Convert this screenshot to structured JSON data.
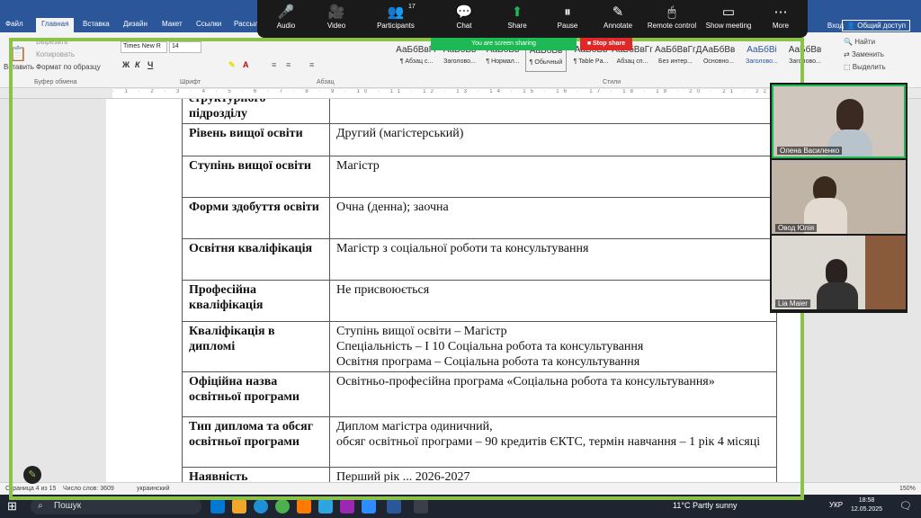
{
  "word": {
    "tabs": [
      "Файл",
      "Главная",
      "Вставка",
      "Дизайн",
      "Макет",
      "Ссылки",
      "Рассыл"
    ],
    "login": "Вход",
    "share": "Общий доступ",
    "clipboard": {
      "paste": "Вставить",
      "cut": "Вырезать",
      "copy": "Копировать",
      "format": "Формат по образцу",
      "group": "Буфер обмена"
    },
    "font": {
      "name": "Times New R",
      "size": "14",
      "group": "Шрифт"
    },
    "paragraph_group": "Абзац",
    "styles_group": "Стили",
    "styles": [
      {
        "preview": "АаБбВвГг",
        "label": "¶ Абзац с..."
      },
      {
        "preview": "АаБбВв",
        "label": "Заголово..."
      },
      {
        "preview": "АаБбВв",
        "label": "¶ Нормал..."
      },
      {
        "preview": "АаБбВв",
        "label": "¶ Обычный"
      },
      {
        "preview": "АаБбВв",
        "label": "¶ Table Pa..."
      },
      {
        "preview": "АаБбВвГг",
        "label": "Абзац сп..."
      },
      {
        "preview": "АаБбВвГгД",
        "label": "Без интер..."
      },
      {
        "preview": "АаБбВв",
        "label": "Основно..."
      },
      {
        "preview": "АаБбВі",
        "label": "Заголово..."
      },
      {
        "preview": "АаБбВв",
        "label": "Заголово..."
      }
    ],
    "editing": {
      "find": "Найти",
      "replace": "Заменить",
      "select": "Выделить"
    }
  },
  "document": {
    "rows": [
      {
        "key": "структурного підрозділу",
        "value": ""
      },
      {
        "key": "Рівень вищої освіти",
        "value": "Другий (магістерський)"
      },
      {
        "key": "Ступінь вищої освіти",
        "value": "Магістр"
      },
      {
        "key": "Форми здобуття освіти",
        "value": "Очна (денна); заочна"
      },
      {
        "key": "Освітня кваліфікація",
        "value": "Магістр з соціальної  роботи та консультування"
      },
      {
        "key": "Професійна кваліфікація",
        "value": "Не присвоюється"
      },
      {
        "key": "Кваліфікація в дипломі",
        "value": "Ступінь вищої освіти – Магістр\nСпеціальність – І 10 Соціальна робота та консультування\nОсвітня програма – Соціальна робота та консультування"
      },
      {
        "key": "Офіційна назва освітньої програми",
        "value": "Освітньо-професійна програма «Соціальна робота та консультування»"
      },
      {
        "key": "Тип диплома та обсяг освітньої програми",
        "value": "Диплом магістра одиничний,\nобсяг освітньої програми – 90 кредитів ЄКТС, термін навчання – 1 рік 4 місяці"
      },
      {
        "key": "Наявність",
        "value": "Перший рік ... 2026-2027"
      }
    ]
  },
  "statusbar": {
    "page": "Страница 4 из 15",
    "words": "Число слов: 3609",
    "lang": "украинский",
    "zoom": "150%"
  },
  "zoom": {
    "buttons": [
      {
        "icon": "🎤",
        "label": "Audio"
      },
      {
        "icon": "🎥",
        "label": "Video"
      },
      {
        "icon": "👥",
        "label": "Participants",
        "badge": "17"
      },
      {
        "icon": "💬",
        "label": "Chat"
      },
      {
        "icon": "⬆",
        "label": "Share"
      },
      {
        "icon": "⏸",
        "label": "Pause"
      },
      {
        "icon": "✎",
        "label": "Annotate"
      },
      {
        "icon": "🖱",
        "label": "Remote control"
      },
      {
        "icon": "▭",
        "label": "Show meeting"
      },
      {
        "icon": "⋯",
        "label": "More"
      }
    ],
    "sharing_banner": "You are screen sharing",
    "stop_share": "Stop share",
    "participants": [
      {
        "name": "Олена Василенко",
        "color": "#c9c1b8"
      },
      {
        "name": "Овод Юлія",
        "color": "#b9b0a4"
      },
      {
        "name": "Lia Maier",
        "color": "#d7d3cd"
      }
    ]
  },
  "taskbar": {
    "search": "Пошук",
    "weather": "11°C  Partly sunny",
    "lang": "УКР",
    "time": "18:58",
    "date": "12.05.2025"
  }
}
